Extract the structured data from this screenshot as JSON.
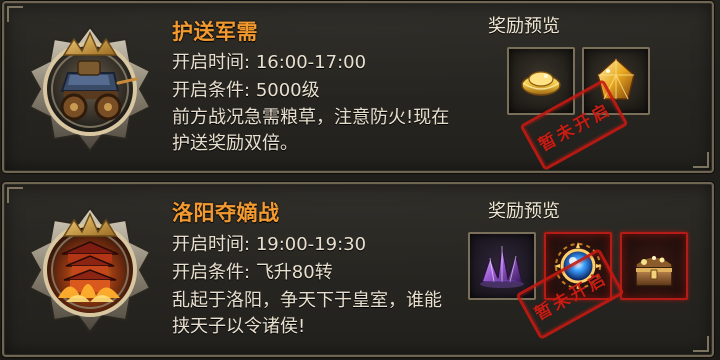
{
  "events": [
    {
      "title": "护送军需",
      "open_time_label": "开启时间:",
      "open_time": "16:00-17:00",
      "condition_label": "开启条件:",
      "condition": "5000级",
      "description": "前方战况急需粮草，注意防火!现在护送奖励双倍。",
      "rewards_title": "奖励预览",
      "rewards": [
        {
          "icon": "gold-ingot-icon"
        },
        {
          "icon": "gold-crystal-icon"
        }
      ],
      "stamp_text": "暂未开启"
    },
    {
      "title": "洛阳夺嫡战",
      "open_time_label": "开启时间:",
      "open_time": "19:00-19:30",
      "condition_label": "开启条件:",
      "condition": "飞升80转",
      "description": "乱起于洛阳，争天下于皇室，谁能挟天子以令诸侯!",
      "rewards_title": "奖励预览",
      "rewards": [
        {
          "icon": "purple-crystal-icon"
        },
        {
          "icon": "blue-orb-icon"
        },
        {
          "icon": "treasure-chest-icon"
        }
      ],
      "stamp_text": "暂未开启"
    }
  ],
  "colors": {
    "title": "#f29a2f",
    "text": "#e8dfcf",
    "stamp": "#c41a12",
    "border": "#6e6553"
  }
}
